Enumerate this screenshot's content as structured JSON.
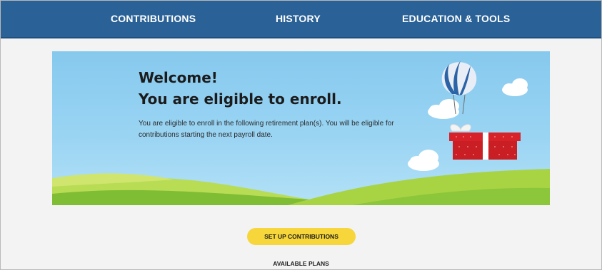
{
  "nav": {
    "items": [
      {
        "label": "CONTRIBUTIONS"
      },
      {
        "label": "HISTORY"
      },
      {
        "label": "EDUCATION & TOOLS"
      }
    ]
  },
  "banner": {
    "title_line1": "Welcome!",
    "title_line2": "You are eligible to enroll.",
    "description": "You are eligible to enroll in the following retirement plan(s). You will be eligible for contributions starting the next payroll date."
  },
  "actions": {
    "setup_label": "SET UP CONTRIBUTIONS"
  },
  "plans": {
    "heading": "AVAILABLE PLANS"
  },
  "colors": {
    "nav_bg": "#2a6196",
    "cta_bg": "#f6d63a",
    "sky": "#9ad4f3",
    "hill": "#9fcf3e",
    "gift": "#d8222a"
  },
  "icons": [
    "hot-air-balloon-icon",
    "gift-box-icon",
    "cloud-icon"
  ]
}
